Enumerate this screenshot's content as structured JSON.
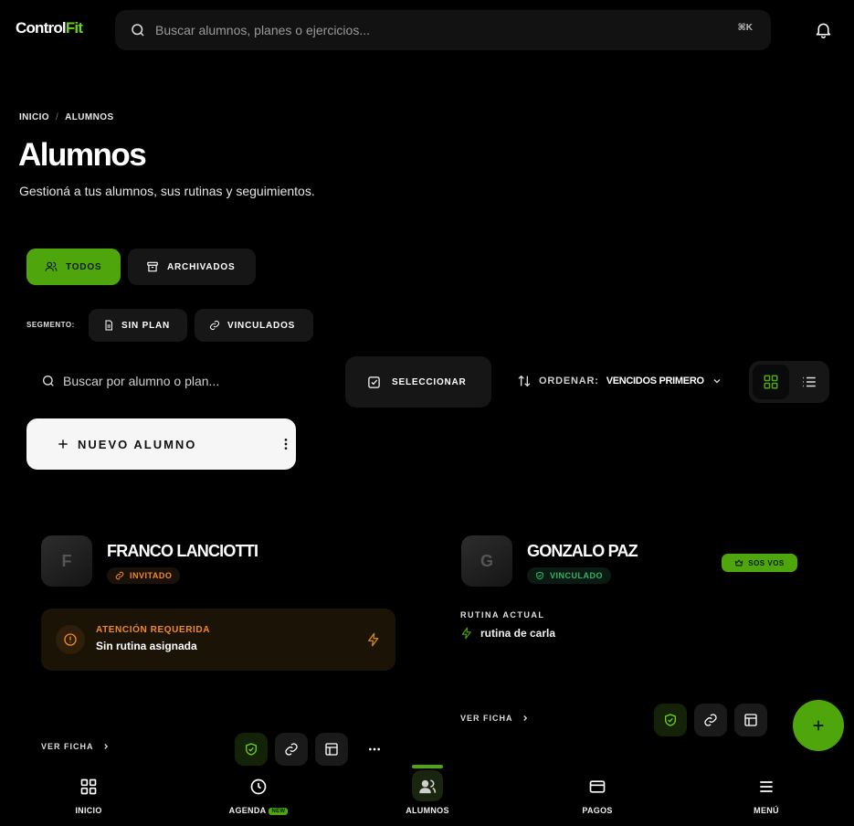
{
  "app": {
    "logo_main": "Control",
    "logo_accent": "Fit"
  },
  "topbar": {
    "search_placeholder": "Buscar alumnos, planes o ejercicios...",
    "shortcut": "⌘K"
  },
  "breadcrumb": {
    "home": "INICIO",
    "separator": "/",
    "current": "ALUMNOS"
  },
  "page": {
    "title": "Alumnos",
    "subtitle": "Gestioná a tus alumnos, sus rutinas y seguimientos."
  },
  "tabs": {
    "todos": "TODOS",
    "archivados": "ARCHIVADOS"
  },
  "segment": {
    "label": "SEGMENTO:",
    "sin_plan": "SIN PLAN",
    "vinculados": "VINCULADOS"
  },
  "toolbar": {
    "search_placeholder": "Buscar por alumno o plan...",
    "select_label": "SELECCIONAR",
    "sort_label": "ORDENAR:",
    "sort_value": "VENCIDOS PRIMERO",
    "new_student": "NUEVO ALUMNO"
  },
  "students": [
    {
      "initial": "F",
      "name": "FRANCO LANCIOTTI",
      "status": "INVITADO",
      "alert_title": "ATENCIÓN REQUERIDA",
      "alert_text": "Sin rutina asignada",
      "link": "VER FICHA"
    },
    {
      "initial": "G",
      "name": "GONZALO PAZ",
      "status": "VINCULADO",
      "badge": "SOS VOS",
      "routine_label": "RUTINA ACTUAL",
      "routine_name": "rutina de carla",
      "link": "VER FICHA"
    }
  ],
  "nav": {
    "inicio": "INICIO",
    "agenda": "AGENDA",
    "agenda_badge": "NEW",
    "alumnos": "ALUMNOS",
    "pagos": "PAGOS",
    "menu": "MENÚ"
  },
  "colors": {
    "accent": "#4fa50c",
    "warning": "#f08a24",
    "linked": "#2fb567",
    "background": "#000000"
  }
}
